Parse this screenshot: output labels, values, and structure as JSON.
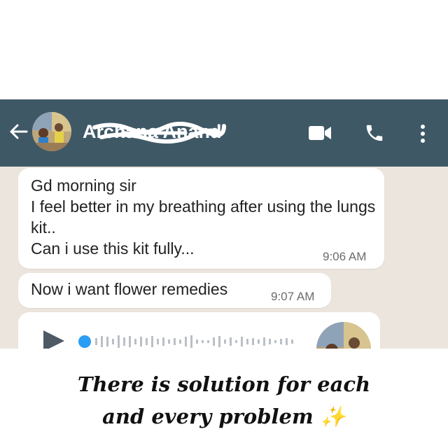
{
  "header": {
    "contact_name": "Archana Anand",
    "bg_color": "#3e5866",
    "icons": [
      "back-arrow-icon",
      "video-call-icon",
      "phone-icon",
      "more-vert-icon"
    ]
  },
  "messages": [
    {
      "text": "Gd morning sir\nI feel better in my breathing after using the lungs kit..\nCan i use this kit fully...",
      "time": "9:06 AM"
    },
    {
      "text": "Now i want flower remedies",
      "time": "9:07 AM"
    }
  ],
  "voice_note": {
    "icon": "play-icon"
  },
  "caption": {
    "line1": "There is solution for each",
    "line2": "and every problem ✨"
  }
}
